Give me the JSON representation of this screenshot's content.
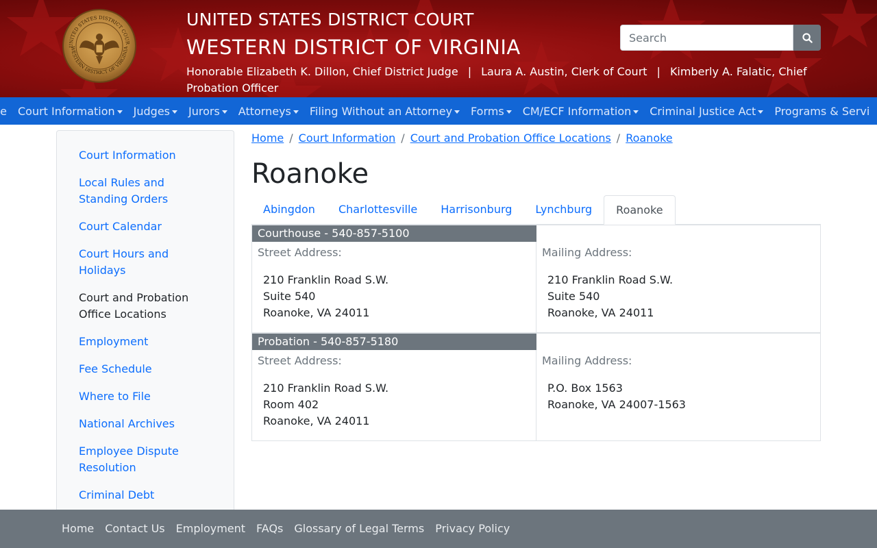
{
  "header": {
    "line1": "UNITED STATES DISTRICT COURT",
    "line2": "WESTERN DISTRICT OF VIRGINIA",
    "officials": [
      "Honorable Elizabeth K. Dillon, Chief District Judge",
      "Laura A. Austin, Clerk of Court",
      "Kimberly A. Falatic, Chief Probation Officer"
    ],
    "separator": "|",
    "seal_icon": "court-seal-icon",
    "seal_text_top": "UNITED STATES DISTRICT COURT",
    "seal_text_bottom": "WESTERN DISTRICT OF VIRGINIA",
    "search": {
      "placeholder": "Search",
      "icon": "search-icon"
    }
  },
  "nav": {
    "items": [
      {
        "label": "ne",
        "dropdown": false
      },
      {
        "label": "Court Information",
        "dropdown": true
      },
      {
        "label": "Judges",
        "dropdown": true
      },
      {
        "label": "Jurors",
        "dropdown": true
      },
      {
        "label": "Attorneys",
        "dropdown": true
      },
      {
        "label": "Filing Without an Attorney",
        "dropdown": true
      },
      {
        "label": "Forms",
        "dropdown": true
      },
      {
        "label": "CM/ECF Information",
        "dropdown": true
      },
      {
        "label": "Criminal Justice Act",
        "dropdown": true
      },
      {
        "label": "Programs & Servi",
        "dropdown": false
      }
    ]
  },
  "sidebar": {
    "items": [
      {
        "label": "Court Information",
        "active": false
      },
      {
        "label": "Local Rules and Standing Orders",
        "active": false
      },
      {
        "label": "Court Calendar",
        "active": false
      },
      {
        "label": "Court Hours and Holidays",
        "active": false
      },
      {
        "label": "Court and Probation Office Locations",
        "active": true
      },
      {
        "label": "Employment",
        "active": false
      },
      {
        "label": "Fee Schedule",
        "active": false
      },
      {
        "label": "Where to File",
        "active": false
      },
      {
        "label": "National Archives",
        "active": false
      },
      {
        "label": "Employee Dispute Resolution",
        "active": false
      },
      {
        "label": "Criminal Debt",
        "active": false
      }
    ]
  },
  "breadcrumb": [
    "Home",
    "Court Information",
    "Court and Probation Office Locations",
    "Roanoke"
  ],
  "breadcrumb_separator": "/",
  "page_title": "Roanoke",
  "tabs": [
    {
      "label": "Abingdon",
      "active": false
    },
    {
      "label": "Charlottesville",
      "active": false
    },
    {
      "label": "Harrisonburg",
      "active": false
    },
    {
      "label": "Lynchburg",
      "active": false
    },
    {
      "label": "Roanoke",
      "active": true
    }
  ],
  "offices": [
    {
      "heading": "Courthouse - 540-857-5100",
      "street_label": "Street Address:",
      "street": [
        "210 Franklin Road S.W.",
        "Suite 540",
        "Roanoke, VA 24011"
      ],
      "mailing_label": "Mailing Address:",
      "mailing": [
        "210 Franklin Road S.W.",
        "Suite 540",
        "Roanoke, VA 24011"
      ]
    },
    {
      "heading": "Probation - 540-857-5180",
      "street_label": "Street Address:",
      "street": [
        "210 Franklin Road S.W.",
        "Room 402",
        "Roanoke, VA 24011"
      ],
      "mailing_label": "Mailing Address:",
      "mailing": [
        "P.O. Box 1563",
        "Roanoke, VA 24007-1563"
      ]
    }
  ],
  "footer": {
    "links": [
      "Home",
      "Contact Us",
      "Employment",
      "FAQs",
      "Glossary of Legal Terms",
      "Privacy Policy"
    ]
  },
  "colors": {
    "header_red": "#8a0d0d",
    "nav_blue": "#1266d6",
    "link_blue": "#0d6efd",
    "card_head_gray": "#6c757d",
    "footer_gray": "#6c757d"
  }
}
